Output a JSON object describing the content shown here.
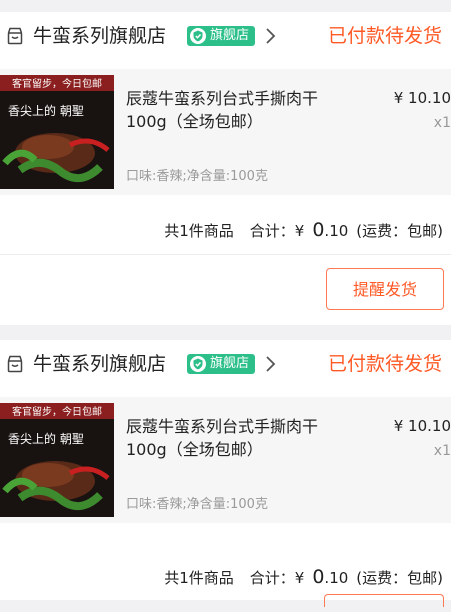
{
  "colors": {
    "accent": "#ff5a26",
    "badge": "#2cbf8a",
    "background": "#f1f1f3"
  },
  "orders": [
    {
      "shop_name": "牛蛮系列旗舰店",
      "badge_label": "旗舰店",
      "status": "已付款待发货",
      "product": {
        "title": "辰蔻牛蛮系列台式手撕肉干100g（全场包邮）",
        "price": "¥ 10.10",
        "quantity": "x1",
        "spec": "口味:香辣;净含量:100克",
        "image_overlay": "客官留步，今日包邮",
        "image_brand": "香尖上的 朝聖"
      },
      "summary": {
        "item_count": "共1件商品",
        "total_label": "合计：",
        "currency": "¥",
        "amount_main": "0",
        "amount_decimal": ".10",
        "shipping": "(运费：包邮)"
      },
      "button_label": "提醒发货"
    },
    {
      "shop_name": "牛蛮系列旗舰店",
      "badge_label": "旗舰店",
      "status": "已付款待发货",
      "product": {
        "title": "辰蔻牛蛮系列台式手撕肉干100g（全场包邮）",
        "price": "¥ 10.10",
        "quantity": "x1",
        "spec": "口味:香辣;净含量:100克",
        "image_overlay": "客官留步，今日包邮",
        "image_brand": "香尖上的 朝聖"
      },
      "summary": {
        "item_count": "共1件商品",
        "total_label": "合计：",
        "currency": "¥",
        "amount_main": "0",
        "amount_decimal": ".10",
        "shipping": "(运费：包邮)"
      }
    }
  ]
}
